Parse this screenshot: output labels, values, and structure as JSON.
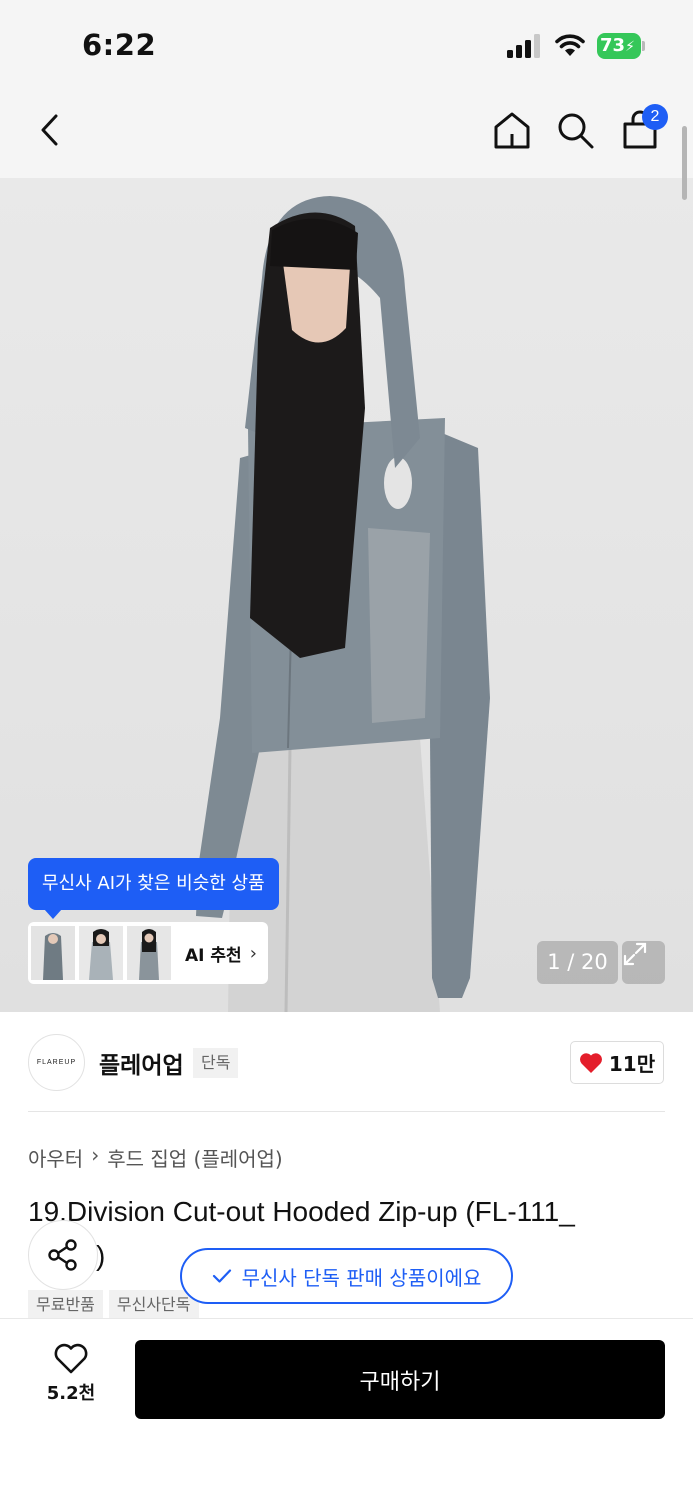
{
  "status_bar": {
    "time": "6:22",
    "battery": "73"
  },
  "nav": {
    "cart_count": "2",
    "back_icon": "chevron-left-icon",
    "home_icon": "home-icon",
    "search_icon": "search-icon",
    "cart_icon": "shopping-bag-icon"
  },
  "gallery": {
    "ai_tooltip": "무신사 AI가 찾은 비슷한 상품",
    "ai_label": "AI 추천",
    "pager": "1 / 20",
    "current_page": 1,
    "total_pages": 20
  },
  "brand": {
    "logo_text": "FLAREUP",
    "name": "플레어업",
    "badge": "단독",
    "likes": "11만"
  },
  "product": {
    "breadcrumb": [
      "아우터",
      "후드 집업 (플레어업)"
    ],
    "title": "19.Division Cut-out Hooded Zip-up (FL-111_",
    "title_line2": ")",
    "exclusive_notice": "무신사 단독 판매 상품이에요",
    "tags": [
      "무료반품",
      "무신사단독"
    ]
  },
  "bottom_bar": {
    "wish_count": "5.2천",
    "buy_label": "구매하기"
  },
  "colors": {
    "accent": "#1e5ef5",
    "like_heart": "#e41e2b",
    "buy_button": "#000000"
  }
}
